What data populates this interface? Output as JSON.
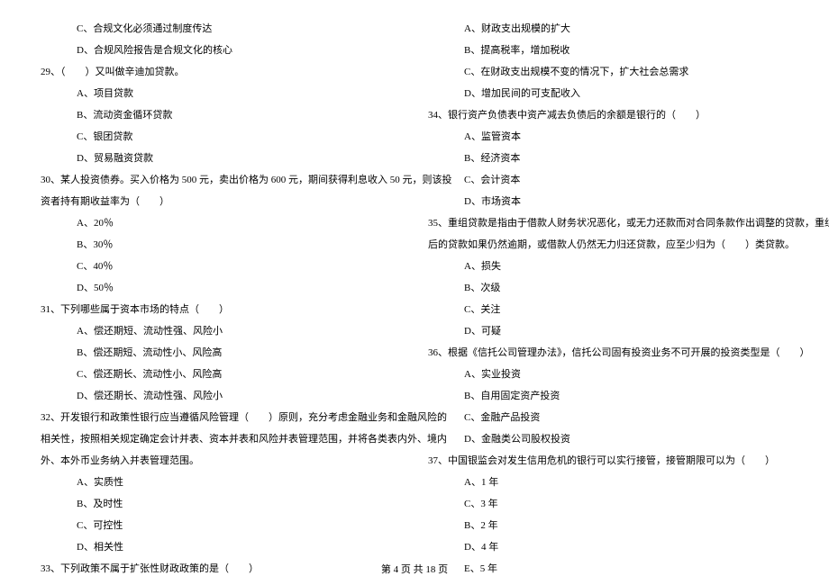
{
  "leftColumn": {
    "q28_optC": "C、合规文化必须通过制度传达",
    "q28_optD": "D、合规风险报告是合规文化的核心",
    "q29_stem": "29、（　　）又叫做辛迪加贷款。",
    "q29_optA": "A、项目贷款",
    "q29_optB": "B、流动资金循环贷款",
    "q29_optC": "C、银团贷款",
    "q29_optD": "D、贸易融资贷款",
    "q30_stem1": "30、某人投资债券。买入价格为 500 元，卖出价格为 600 元，期间获得利息收入 50 元，则该投",
    "q30_stem2": "资者持有期收益率为（　　）",
    "q30_optA": "A、20％",
    "q30_optB": "B、30％",
    "q30_optC": "C、40％",
    "q30_optD": "D、50％",
    "q31_stem": "31、下列哪些属于资本市场的特点（　　）",
    "q31_optA": "A、偿还期短、流动性强、风险小",
    "q31_optB": "B、偿还期短、流动性小、风险高",
    "q31_optC": "C、偿还期长、流动性小、风险高",
    "q31_optD": "D、偿还期长、流动性强、风险小",
    "q32_stem1": "32、开发银行和政策性银行应当遵循风险管理（　　）原则，充分考虑金融业务和金融风险的",
    "q32_stem2": "相关性，按照相关规定确定会计并表、资本并表和风险并表管理范围，并将各类表内外、境内",
    "q32_stem3": "外、本外币业务纳入并表管理范围。",
    "q32_optA": "A、实质性",
    "q32_optB": "B、及时性",
    "q32_optC": "C、可控性",
    "q32_optD": "D、相关性",
    "q33_stem": "33、下列政策不属于扩张性财政政策的是（　　）"
  },
  "rightColumn": {
    "q33_optA": "A、财政支出规模的扩大",
    "q33_optB": "B、提高税率，增加税收",
    "q33_optC": "C、在财政支出规模不变的情况下，扩大社会总需求",
    "q33_optD": "D、增加民间的可支配收入",
    "q34_stem": "34、银行资产负债表中资产减去负债后的余额是银行的（　　）",
    "q34_optA": "A、监管资本",
    "q34_optB": "B、经济资本",
    "q34_optC": "C、会计资本",
    "q34_optD": "D、市场资本",
    "q35_stem1": "35、重组贷款是指由于借款人财务状况恶化，或无力还款而对合同条款作出调整的贷款，重组",
    "q35_stem2": "后的贷款如果仍然逾期，或借款人仍然无力归还贷款，应至少归为（　　）类贷款。",
    "q35_optA": "A、损失",
    "q35_optB": "B、次级",
    "q35_optC": "C、关注",
    "q35_optD": "D、可疑",
    "q36_stem": "36、根据《信托公司管理办法》，信托公司固有投资业务不可开展的投资类型是（　　）",
    "q36_optA": "A、实业投资",
    "q36_optB": "B、自用固定资产投资",
    "q36_optC": "C、金融产品投资",
    "q36_optD": "D、金融类公司股权投资",
    "q37_stem": "37、中国银监会对发生信用危机的银行可以实行接管，接管期限可以为（　　）",
    "q37_optA": "A、1 年",
    "q37_optC": "C、3 年",
    "q37_optB": "B、2 年",
    "q37_optD": "D、4 年",
    "q37_optE": "E、5 年"
  },
  "footer": "第 4 页 共 18 页"
}
